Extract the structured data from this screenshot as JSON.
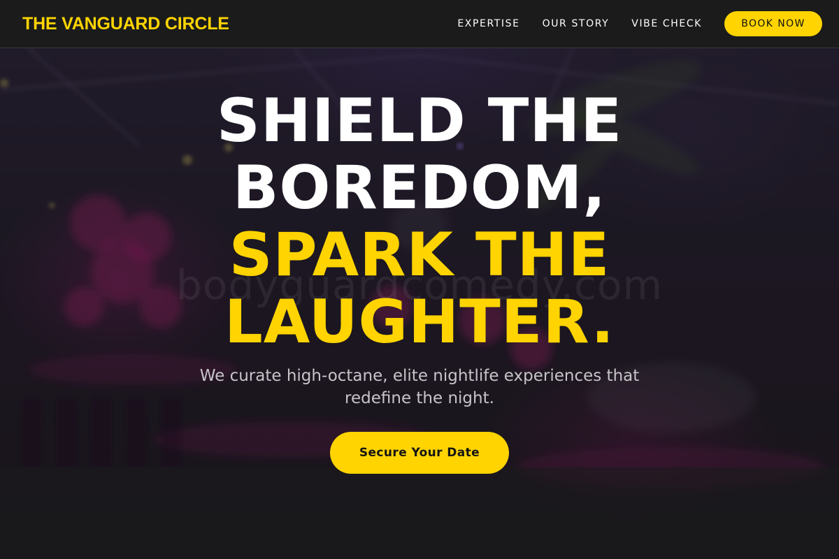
{
  "header": {
    "logo": "THE VANGUARD CIRCLE",
    "nav": [
      {
        "label": "EXPERTISE"
      },
      {
        "label": "OUR STORY"
      },
      {
        "label": "VIBE CHECK"
      }
    ],
    "book_label": "BOOK NOW"
  },
  "hero": {
    "headline_white_1": "SHIELD THE",
    "headline_white_2": "BOREDOM,",
    "headline_yellow_1": "SPARK THE",
    "headline_yellow_2": "LAUGHTER.",
    "subhead_1": "We curate high-octane, elite nightlife experiences that",
    "subhead_2": "redefine the night.",
    "cta_label": "Secure Your Date",
    "watermark": "bodyguardcomedy.com",
    "background_image": "dark purple event venue with magenta floral arrangements"
  },
  "colors": {
    "accent": "#ffd400",
    "header_bg": "#1b1b1b",
    "hero_bg": "#221c26"
  }
}
